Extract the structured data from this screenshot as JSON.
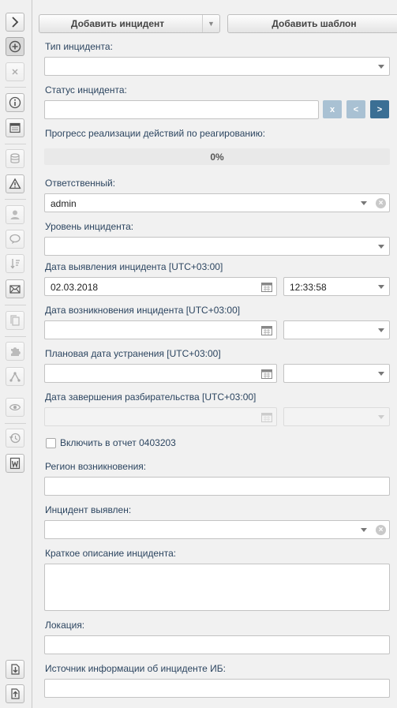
{
  "toolbar": {
    "add_incident": "Добавить инцидент",
    "add_template": "Добавить шаблон"
  },
  "sidebar": {
    "icons": [
      "chevron-right-icon",
      "add-circle-icon",
      "close-icon",
      "info-icon",
      "calendar-icon",
      "database-icon",
      "warning-icon",
      "user-icon",
      "chat-icon",
      "sort-icon",
      "mail-icon",
      "copy-icon",
      "puzzle-icon",
      "workflow-icon",
      "eye-icon",
      "history-icon",
      "word-icon",
      "download-icon",
      "upload-icon"
    ]
  },
  "form": {
    "incident_type_label": "Тип инцидента:",
    "incident_type_value": "",
    "status_label": "Статус инцидента:",
    "status_value": "",
    "status_btn_clear": "x",
    "status_btn_prev": "<",
    "status_btn_next": ">",
    "progress_label": "Прогресс реализации действий по реагированию:",
    "progress_text": "0%",
    "progress_value": 0,
    "responsible_label": "Ответственный:",
    "responsible_value": "admin",
    "level_label": "Уровень инцидента:",
    "level_value": "",
    "detect_date_label": "Дата выявления инцидента [UTC+03:00]",
    "detect_date_value": "02.03.2018",
    "detect_time_value": "12:33:58",
    "occur_date_label": "Дата возникновения инцидента [UTC+03:00]",
    "occur_date_value": "",
    "occur_time_value": "",
    "planned_date_label": "Плановая дата устранения [UTC+03:00]",
    "planned_date_value": "",
    "planned_time_value": "",
    "closing_date_label": "Дата завершения разбирательства [UTC+03:00]",
    "closing_date_value": "",
    "closing_time_value": "",
    "include_report_label": "Включить в отчет 0403203",
    "include_report_checked": false,
    "region_label": "Регион возникновения:",
    "region_value": "",
    "detected_by_label": "Инцидент выявлен:",
    "detected_by_value": "",
    "description_label": "Краткое описание инцидента:",
    "description_value": "",
    "location_label": "Локация:",
    "location_value": "",
    "source_label": "Источник информации об инциденте ИБ:",
    "source_value": ""
  },
  "colors": {
    "label": "#2c4560",
    "btn_light": "#a9c1d3",
    "btn_dark": "#3b6f94"
  }
}
